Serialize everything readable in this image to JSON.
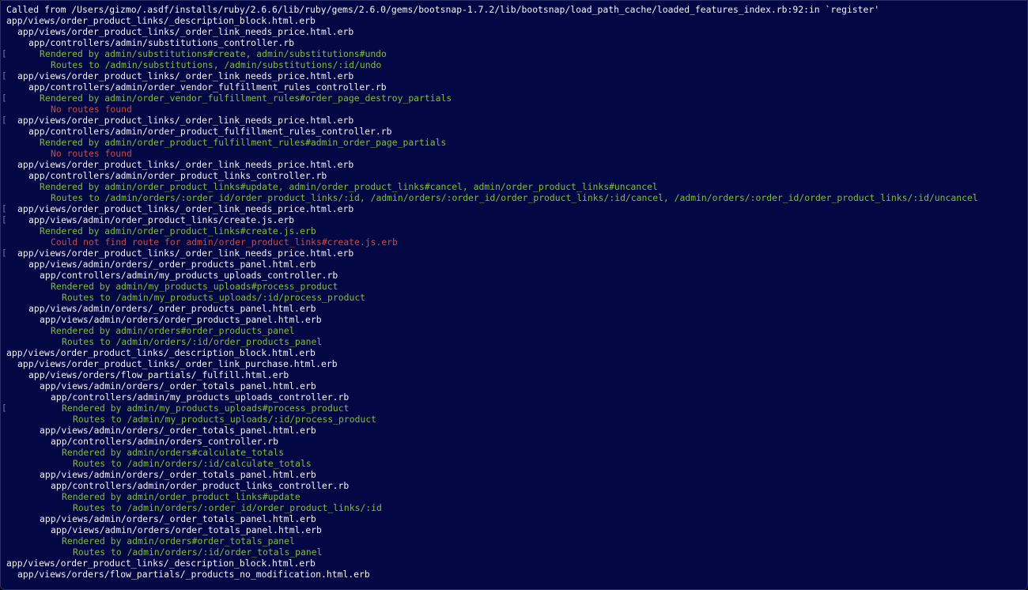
{
  "colors": {
    "background": "#030845",
    "path": "#f2f3f8",
    "info": "#7fbe3a",
    "error": "#d0483d"
  },
  "lines": [
    {
      "indent": 0,
      "color": "white",
      "marker": false,
      "text": "Called from /Users/gizmo/.asdf/installs/ruby/2.6.6/lib/ruby/gems/2.6.0/gems/bootsnap-1.7.2/lib/bootsnap/load_path_cache/loaded_features_index.rb:92:in `register'"
    },
    {
      "indent": 0,
      "color": "white",
      "marker": false,
      "text": "app/views/order_product_links/_description_block.html.erb"
    },
    {
      "indent": 1,
      "color": "white",
      "marker": false,
      "text": "app/views/order_product_links/_order_link_needs_price.html.erb"
    },
    {
      "indent": 2,
      "color": "white",
      "marker": false,
      "text": "app/controllers/admin/substitutions_controller.rb"
    },
    {
      "indent": 3,
      "color": "green",
      "marker": true,
      "text": "Rendered by admin/substitutions#create, admin/substitutions#undo"
    },
    {
      "indent": 4,
      "color": "green",
      "marker": false,
      "text": "Routes to /admin/substitutions, /admin/substitutions/:id/undo"
    },
    {
      "indent": 1,
      "color": "white",
      "marker": true,
      "text": "app/views/order_product_links/_order_link_needs_price.html.erb"
    },
    {
      "indent": 2,
      "color": "white",
      "marker": false,
      "text": "app/controllers/admin/order_vendor_fulfillment_rules_controller.rb"
    },
    {
      "indent": 3,
      "color": "green",
      "marker": true,
      "text": "Rendered by admin/order_vendor_fulfillment_rules#order_page_destroy_partials"
    },
    {
      "indent": 4,
      "color": "red",
      "marker": false,
      "text": "No routes found"
    },
    {
      "indent": 1,
      "color": "white",
      "marker": true,
      "text": "app/views/order_product_links/_order_link_needs_price.html.erb"
    },
    {
      "indent": 2,
      "color": "white",
      "marker": false,
      "text": "app/controllers/admin/order_product_fulfillment_rules_controller.rb"
    },
    {
      "indent": 3,
      "color": "green",
      "marker": false,
      "text": "Rendered by admin/order_product_fulfillment_rules#admin_order_page_partials"
    },
    {
      "indent": 4,
      "color": "red",
      "marker": false,
      "text": "No routes found"
    },
    {
      "indent": 1,
      "color": "white",
      "marker": false,
      "text": "app/views/order_product_links/_order_link_needs_price.html.erb"
    },
    {
      "indent": 2,
      "color": "white",
      "marker": false,
      "text": "app/controllers/admin/order_product_links_controller.rb"
    },
    {
      "indent": 3,
      "color": "green",
      "marker": false,
      "text": "Rendered by admin/order_product_links#update, admin/order_product_links#cancel, admin/order_product_links#uncancel"
    },
    {
      "indent": 4,
      "color": "green",
      "marker": false,
      "text": "Routes to /admin/orders/:order_id/order_product_links/:id, /admin/orders/:order_id/order_product_links/:id/cancel, /admin/orders/:order_id/order_product_links/:id/uncancel"
    },
    {
      "indent": 1,
      "color": "white",
      "marker": true,
      "text": "app/views/order_product_links/_order_link_needs_price.html.erb"
    },
    {
      "indent": 2,
      "color": "white",
      "marker": true,
      "text": "app/views/admin/order_product_links/create.js.erb"
    },
    {
      "indent": 3,
      "color": "green",
      "marker": false,
      "text": "Rendered by admin/order_product_links#create.js.erb"
    },
    {
      "indent": 4,
      "color": "red",
      "marker": false,
      "text": "Could not find route for admin/order_product_links#create.js.erb"
    },
    {
      "indent": 1,
      "color": "white",
      "marker": true,
      "text": "app/views/order_product_links/_order_link_needs_price.html.erb"
    },
    {
      "indent": 2,
      "color": "white",
      "marker": false,
      "text": "app/views/admin/orders/_order_products_panel.html.erb"
    },
    {
      "indent": 3,
      "color": "white",
      "marker": false,
      "text": "app/controllers/admin/my_products_uploads_controller.rb"
    },
    {
      "indent": 4,
      "color": "green",
      "marker": false,
      "text": "Rendered by admin/my_products_uploads#process_product"
    },
    {
      "indent": 5,
      "color": "green",
      "marker": false,
      "text": "Routes to /admin/my_products_uploads/:id/process_product"
    },
    {
      "indent": 2,
      "color": "white",
      "marker": false,
      "text": "app/views/admin/orders/_order_products_panel.html.erb"
    },
    {
      "indent": 3,
      "color": "white",
      "marker": false,
      "text": "app/views/admin/orders/order_products_panel.html.erb"
    },
    {
      "indent": 4,
      "color": "green",
      "marker": false,
      "text": "Rendered by admin/orders#order_products_panel"
    },
    {
      "indent": 5,
      "color": "green",
      "marker": false,
      "text": "Routes to /admin/orders/:id/order_products_panel"
    },
    {
      "indent": 0,
      "color": "white",
      "marker": false,
      "text": "app/views/order_product_links/_description_block.html.erb"
    },
    {
      "indent": 1,
      "color": "white",
      "marker": false,
      "text": "app/views/order_product_links/_order_link_purchase.html.erb"
    },
    {
      "indent": 2,
      "color": "white",
      "marker": false,
      "text": "app/views/orders/flow_partials/_fulfill.html.erb"
    },
    {
      "indent": 3,
      "color": "white",
      "marker": false,
      "text": "app/views/admin/orders/_order_totals_panel.html.erb"
    },
    {
      "indent": 4,
      "color": "white",
      "marker": false,
      "text": "app/controllers/admin/my_products_uploads_controller.rb"
    },
    {
      "indent": 5,
      "color": "green",
      "marker": true,
      "text": "Rendered by admin/my_products_uploads#process_product"
    },
    {
      "indent": 6,
      "color": "green",
      "marker": false,
      "text": "Routes to /admin/my_products_uploads/:id/process_product"
    },
    {
      "indent": 3,
      "color": "white",
      "marker": false,
      "text": "app/views/admin/orders/_order_totals_panel.html.erb"
    },
    {
      "indent": 4,
      "color": "white",
      "marker": false,
      "text": "app/controllers/admin/orders_controller.rb"
    },
    {
      "indent": 5,
      "color": "green",
      "marker": false,
      "text": "Rendered by admin/orders#calculate_totals"
    },
    {
      "indent": 6,
      "color": "green",
      "marker": false,
      "text": "Routes to /admin/orders/:id/calculate_totals"
    },
    {
      "indent": 3,
      "color": "white",
      "marker": false,
      "text": "app/views/admin/orders/_order_totals_panel.html.erb"
    },
    {
      "indent": 4,
      "color": "white",
      "marker": false,
      "text": "app/controllers/admin/order_product_links_controller.rb"
    },
    {
      "indent": 5,
      "color": "green",
      "marker": false,
      "text": "Rendered by admin/order_product_links#update"
    },
    {
      "indent": 6,
      "color": "green",
      "marker": false,
      "text": "Routes to /admin/orders/:order_id/order_product_links/:id"
    },
    {
      "indent": 3,
      "color": "white",
      "marker": false,
      "text": "app/views/admin/orders/_order_totals_panel.html.erb"
    },
    {
      "indent": 4,
      "color": "white",
      "marker": false,
      "text": "app/views/admin/orders/order_totals_panel.html.erb"
    },
    {
      "indent": 5,
      "color": "green",
      "marker": false,
      "text": "Rendered by admin/orders#order_totals_panel"
    },
    {
      "indent": 6,
      "color": "green",
      "marker": false,
      "text": "Routes to /admin/orders/:id/order_totals_panel"
    },
    {
      "indent": 0,
      "color": "white",
      "marker": false,
      "text": "app/views/order_product_links/_description_block.html.erb"
    },
    {
      "indent": 1,
      "color": "white",
      "marker": false,
      "text": "app/views/orders/flow_partials/_products_no_modification.html.erb"
    }
  ]
}
